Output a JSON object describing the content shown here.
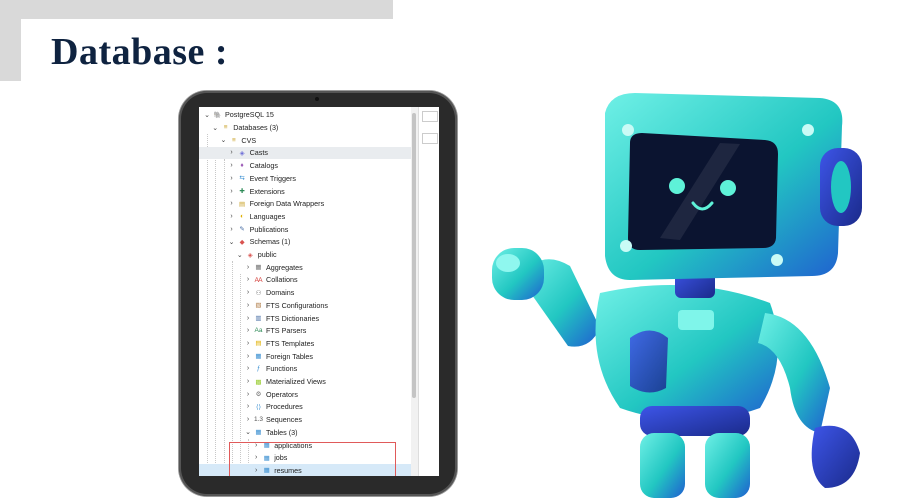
{
  "slide": {
    "title": "Database :"
  },
  "tree": {
    "items": [
      {
        "label": "PostgreSQL 15",
        "chev": "⌄",
        "icon": "elephant-icon",
        "glyph": "🐘",
        "color": "#336791"
      },
      {
        "label": "Databases (3)",
        "chev": "⌄",
        "icon": "databases-icon",
        "glyph": "≡",
        "color": "#c9a227"
      },
      {
        "label": "CVS",
        "chev": "⌄",
        "icon": "database-icon",
        "glyph": "≡",
        "color": "#c9a227"
      },
      {
        "label": "Casts",
        "chev": "›",
        "icon": "casts-icon",
        "glyph": "◈",
        "color": "#6f6fd8",
        "highlight": true
      },
      {
        "label": "Catalogs",
        "chev": "›",
        "icon": "catalogs-icon",
        "glyph": "♦",
        "color": "#9b59b6"
      },
      {
        "label": "Event Triggers",
        "chev": "›",
        "icon": "event-triggers-icon",
        "glyph": "⇆",
        "color": "#3a8fd1"
      },
      {
        "label": "Extensions",
        "chev": "›",
        "icon": "extensions-icon",
        "glyph": "✚",
        "color": "#2e8b57"
      },
      {
        "label": "Foreign Data Wrappers",
        "chev": "›",
        "icon": "fdw-icon",
        "glyph": "▤",
        "color": "#c9a227"
      },
      {
        "label": "Languages",
        "chev": "›",
        "icon": "languages-icon",
        "glyph": "◐",
        "color": "#e0b000"
      },
      {
        "label": "Publications",
        "chev": "›",
        "icon": "publications-icon",
        "glyph": "✎",
        "color": "#4a6fa5"
      },
      {
        "label": "Schemas (1)",
        "chev": "⌄",
        "icon": "schemas-icon",
        "glyph": "◆",
        "color": "#d9534f"
      },
      {
        "label": "public",
        "chev": "⌄",
        "icon": "schema-public-icon",
        "glyph": "◈",
        "color": "#d9534f"
      },
      {
        "label": "Aggregates",
        "chev": "›",
        "icon": "aggregates-icon",
        "glyph": "▦",
        "color": "#777"
      },
      {
        "label": "Collations",
        "chev": "›",
        "icon": "collations-icon",
        "glyph": "Ꜳ",
        "color": "#d9534f"
      },
      {
        "label": "Domains",
        "chev": "›",
        "icon": "domains-icon",
        "glyph": "⚇",
        "color": "#777"
      },
      {
        "label": "FTS Configurations",
        "chev": "›",
        "icon": "fts-configurations-icon",
        "glyph": "▧",
        "color": "#b07d48"
      },
      {
        "label": "FTS Dictionaries",
        "chev": "›",
        "icon": "fts-dictionaries-icon",
        "glyph": "▥",
        "color": "#4a6fa5"
      },
      {
        "label": "FTS Parsers",
        "chev": "›",
        "icon": "fts-parsers-icon",
        "glyph": "Aa",
        "color": "#2e8b57"
      },
      {
        "label": "FTS Templates",
        "chev": "›",
        "icon": "fts-templates-icon",
        "glyph": "▤",
        "color": "#e0b000"
      },
      {
        "label": "Foreign Tables",
        "chev": "›",
        "icon": "foreign-tables-icon",
        "glyph": "▦",
        "color": "#3a8fd1"
      },
      {
        "label": "Functions",
        "chev": "›",
        "icon": "functions-icon",
        "glyph": "ƒ",
        "color": "#3a8fd1"
      },
      {
        "label": "Materialized Views",
        "chev": "›",
        "icon": "materialized-views-icon",
        "glyph": "▩",
        "color": "#9acd32"
      },
      {
        "label": "Operators",
        "chev": "›",
        "icon": "operators-icon",
        "glyph": "⚙",
        "color": "#777"
      },
      {
        "label": "Procedures",
        "chev": "›",
        "icon": "procedures-icon",
        "glyph": "⟨⟩",
        "color": "#3a8fd1"
      },
      {
        "label": "Sequences",
        "chev": "›",
        "icon": "sequences-icon",
        "glyph": "1.3",
        "color": "#555"
      },
      {
        "label": "Tables (3)",
        "chev": "⌄",
        "icon": "tables-icon",
        "glyph": "▦",
        "color": "#3a8fd1"
      },
      {
        "label": "applications",
        "chev": "›",
        "icon": "table-icon",
        "glyph": "▦",
        "color": "#3a8fd1"
      },
      {
        "label": "jobs",
        "chev": "›",
        "icon": "table-icon",
        "glyph": "▦",
        "color": "#3a8fd1"
      },
      {
        "label": "resumes",
        "chev": "›",
        "icon": "table-icon",
        "glyph": "▦",
        "color": "#3a8fd1",
        "selected": true
      }
    ]
  },
  "robot": {
    "body_color": "#2fd3c9",
    "dark_color": "#1f3fb8",
    "screen_color": "#0b1430"
  }
}
